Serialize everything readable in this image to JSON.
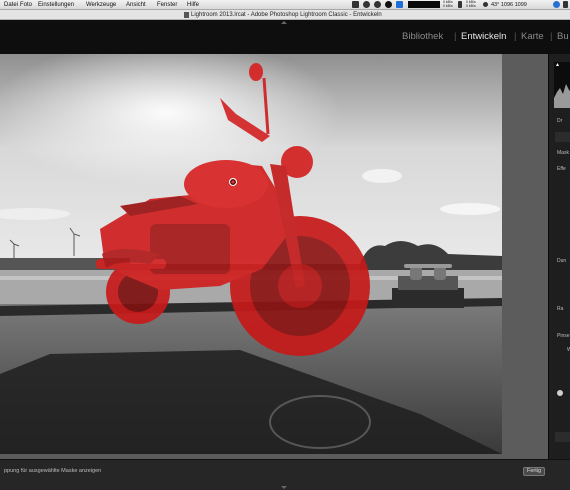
{
  "menubar": {
    "items": [
      "Datei",
      "Foto",
      "Einstellungen",
      "Werkzeuge",
      "Ansicht",
      "Fenster",
      "Hilfe"
    ],
    "status_stack_1": [
      "0 kB/s",
      "0 kB/s"
    ],
    "status_stack_2": [
      "0 kB/s",
      "0 kB/s"
    ],
    "weather": "43° 1096 1099"
  },
  "window": {
    "title": "Lightroom 2013.lrcat - Adobe Photoshop Lightroom Classic - Entwickeln"
  },
  "modules": {
    "items": [
      {
        "label": "Bibliothek",
        "active": false
      },
      {
        "label": "Entwickeln",
        "active": true
      },
      {
        "label": "Karte",
        "active": false
      },
      {
        "label": "Bu",
        "active": false
      }
    ],
    "separator": "|"
  },
  "right_panel": {
    "labels": [
      "Dr",
      "Mask",
      "Effe",
      "Dun",
      "Ra",
      "Pinse",
      "W"
    ]
  },
  "toolbar": {
    "overlay_label": "ppung für ausgewählte Maske anzeigen",
    "done_label": "Fertig"
  },
  "colors": {
    "mask_overlay": "#d41f1f",
    "active_module": "#e6e6e6",
    "inactive_module": "#8a8a8a"
  }
}
